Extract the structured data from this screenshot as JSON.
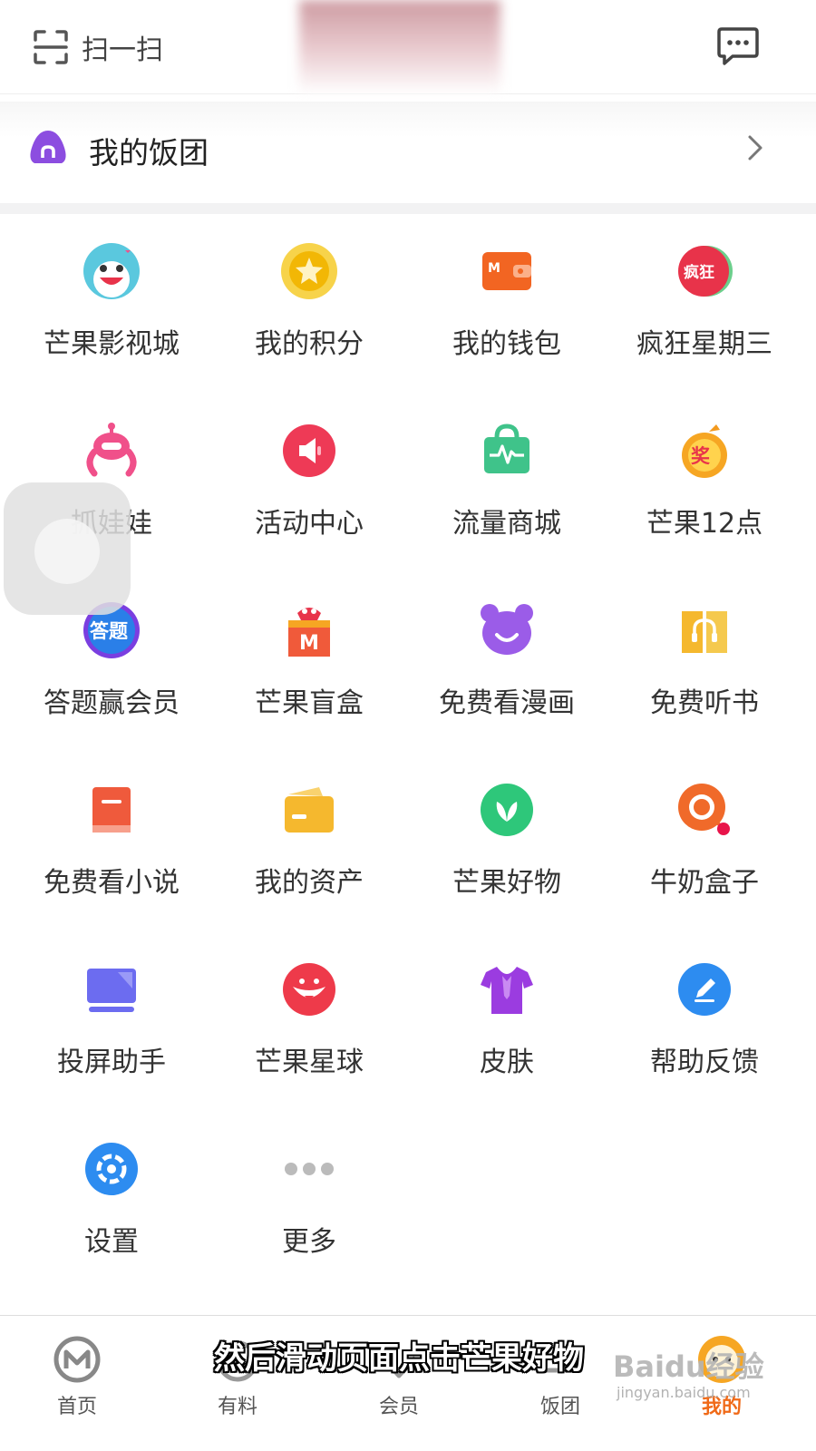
{
  "header": {
    "scan_label": "扫一扫",
    "scan_icon": "scan-icon",
    "message_icon": "message-icon"
  },
  "group_row": {
    "label": "我的饭团",
    "icon": "rice-ball-icon"
  },
  "grid_items": [
    {
      "label": "芒果影视城",
      "icon": "mango-cinema-icon",
      "color": "#4fc3d8"
    },
    {
      "label": "我的积分",
      "icon": "points-star-icon",
      "color": "#f5c518"
    },
    {
      "label": "我的钱包",
      "icon": "wallet-icon",
      "color": "#f26522"
    },
    {
      "label": "疯狂星期三",
      "icon": "crazy-wednesday-icon",
      "color": "#e8334a"
    },
    {
      "label": "抓娃娃",
      "icon": "claw-machine-icon",
      "color": "#f0508a"
    },
    {
      "label": "活动中心",
      "icon": "activity-center-icon",
      "color": "#ee3a56"
    },
    {
      "label": "流量商城",
      "icon": "data-store-icon",
      "color": "#3fc38a"
    },
    {
      "label": "芒果12点",
      "icon": "mango-12-icon",
      "color": "#f39a1e"
    },
    {
      "label": "答题赢会员",
      "icon": "quiz-icon",
      "color": "#2a7fe8"
    },
    {
      "label": "芒果盲盒",
      "icon": "blind-box-icon",
      "color": "#f05a3a"
    },
    {
      "label": "免费看漫画",
      "icon": "comic-bear-icon",
      "color": "#9b5ce8"
    },
    {
      "label": "免费听书",
      "icon": "audiobook-icon",
      "color": "#f5b82e"
    },
    {
      "label": "免费看小说",
      "icon": "novel-book-icon",
      "color": "#ef5a3c"
    },
    {
      "label": "我的资产",
      "icon": "assets-card-icon",
      "color": "#f5b82e"
    },
    {
      "label": "芒果好物",
      "icon": "mango-goods-icon",
      "color": "#2ec77a"
    },
    {
      "label": "牛奶盒子",
      "icon": "milk-box-icon",
      "color": "#f06a2a"
    },
    {
      "label": "投屏助手",
      "icon": "screen-cast-icon",
      "color": "#6c6cf0"
    },
    {
      "label": "芒果星球",
      "icon": "mango-planet-icon",
      "color": "#ee3a4a"
    },
    {
      "label": "皮肤",
      "icon": "skin-shirt-icon",
      "color": "#9b3ce0"
    },
    {
      "label": "帮助反馈",
      "icon": "help-feedback-icon",
      "color": "#2d8cf0"
    },
    {
      "label": "设置",
      "icon": "settings-gear-icon",
      "color": "#2d8cf0"
    },
    {
      "label": "更多",
      "icon": "more-dots-icon",
      "color": "#bbbbbb"
    }
  ],
  "tabs": [
    {
      "label": "首页",
      "icon": "home-m-icon"
    },
    {
      "label": "有料",
      "icon": "discover-icon"
    },
    {
      "label": "会员",
      "icon": "vip-icon"
    },
    {
      "label": "饭团",
      "icon": "fantuan-icon"
    },
    {
      "label": "我的",
      "icon": "profile-icon",
      "active": true
    }
  ],
  "caption": "然后滑动页面点击芒果好物",
  "watermark": {
    "main": "Baidu经验",
    "sub": "jingyan.baidu.com"
  }
}
